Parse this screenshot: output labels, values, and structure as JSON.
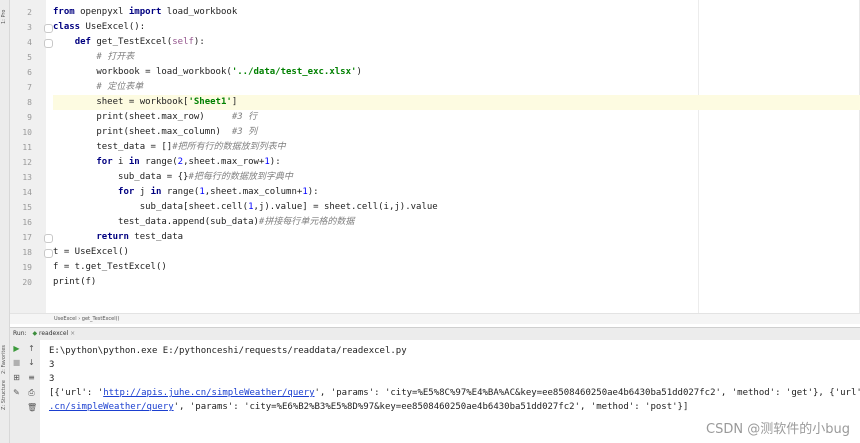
{
  "tool_strip": {
    "project_label": "1: Pro",
    "structure_label": "Z: Structure",
    "favorites_label": "2: Favorites"
  },
  "editor": {
    "lines": [
      {
        "n": "2",
        "code": "from openpyxl import load_workbook"
      },
      {
        "n": "3",
        "code": "class UseExcel():"
      },
      {
        "n": "4",
        "code": "    def get_TestExcel(self):"
      },
      {
        "n": "5",
        "code": "        # 打开表"
      },
      {
        "n": "6",
        "code": "        workbook = load_workbook('../data/test_exc.xlsx')"
      },
      {
        "n": "7",
        "code": "        # 定位表单"
      },
      {
        "n": "8",
        "code": "        sheet = workbook['Sheet1']"
      },
      {
        "n": "9",
        "code": "        print(sheet.max_row)     #3 行"
      },
      {
        "n": "10",
        "code": "        print(sheet.max_column)  #3 列"
      },
      {
        "n": "11",
        "code": "        test_data = []#把所有行的数据放到列表中"
      },
      {
        "n": "12",
        "code": "        for i in range(2,sheet.max_row+1):"
      },
      {
        "n": "13",
        "code": "            sub_data = {}#把每行的数据放到字典中"
      },
      {
        "n": "14",
        "code": "            for j in range(1,sheet.max_column+1):"
      },
      {
        "n": "15",
        "code": "                sub_data[sheet.cell(1,j).value] = sheet.cell(i,j).value"
      },
      {
        "n": "16",
        "code": "            test_data.append(sub_data)#拼接每行单元格的数据"
      },
      {
        "n": "17",
        "code": "        return test_data"
      },
      {
        "n": "18",
        "code": "t = UseExcel()"
      },
      {
        "n": "19",
        "code": "f = t.get_TestExcel()"
      },
      {
        "n": "20",
        "code": "print(f)"
      }
    ],
    "breadcrumb": [
      "UseExcel",
      "get_TestExcel()"
    ]
  },
  "run_panel": {
    "run_label": "Run:",
    "tab_label": "readexcel",
    "console_lines": [
      "E:\\python\\python.exe E:/pythonceshi/requests/readdata/readexcel.py",
      "3",
      "3",
      "[{'url': 'http://apis.juhe.cn/simpleWeather/query', 'params': 'city=%E5%8C%97%E4%BA%AC&key=ee8508460250ae4b6430ba51dd027fc2', 'method': 'get'}, {'url': 'h",
      ".cn/simpleWeather/query', 'params': 'city=%E6%B2%B3%E5%8D%97&key=ee8508460250ae4b6430ba51dd027fc2', 'method': 'post'}]"
    ]
  },
  "watermark": "CSDN @测软件的小bug"
}
